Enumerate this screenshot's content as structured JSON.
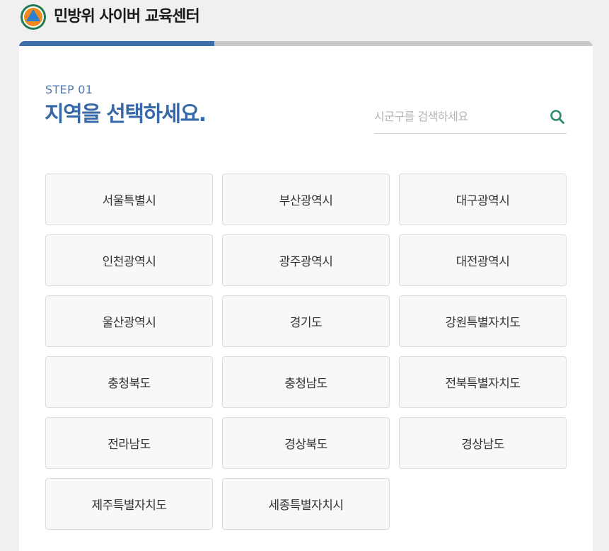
{
  "header": {
    "site_title": "민방위 사이버 교육센터",
    "logo_icon": "civil-defense-emblem-icon",
    "colors": {
      "ring": "#1e7a4f",
      "disc": "#f08a1e",
      "triangle": "#2d7fd4"
    }
  },
  "progress": {
    "fraction": 0.34,
    "fill_color": "#3e6eaa",
    "track_color": "#c9c9c9"
  },
  "step": {
    "label": "STEP 01",
    "title": "지역을 선택하세요."
  },
  "search": {
    "placeholder": "시군구를 검색하세요",
    "value": "",
    "icon": "search-icon",
    "icon_color": "#2e8a6a"
  },
  "regions": [
    "서울특별시",
    "부산광역시",
    "대구광역시",
    "인천광역시",
    "광주광역시",
    "대전광역시",
    "울산광역시",
    "경기도",
    "강원특별자치도",
    "충청북도",
    "충청남도",
    "전북특별자치도",
    "전라남도",
    "경상북도",
    "경상남도",
    "제주특별자치도",
    "세종특별자치시"
  ]
}
